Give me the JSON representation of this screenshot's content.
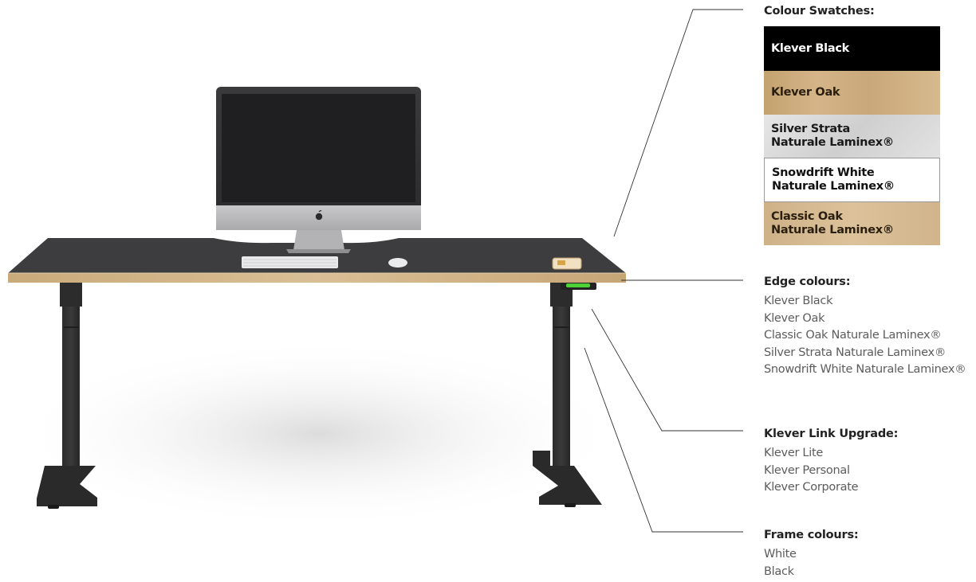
{
  "swatches": {
    "title": "Colour Swatches:",
    "items": [
      {
        "label": "Klever Black",
        "fill": "#000000",
        "text_color": "#ffffff"
      },
      {
        "label": "Klever Oak",
        "fill": "#c9a97b",
        "text_color": "#2a1e10"
      },
      {
        "label": "Silver Strata\nNaturale Laminex®",
        "fill": "#d9d9d9",
        "text_color": "#1a1a1a"
      },
      {
        "label": "Snowdrift White\nNaturale Laminex®",
        "fill": "#ffffff",
        "text_color": "#111111"
      },
      {
        "label": "Classic Oak\nNaturale Laminex®",
        "fill": "#d5b98f",
        "text_color": "#2a1e10"
      }
    ]
  },
  "edge": {
    "title": "Edge colours:",
    "items": [
      "Klever Black",
      "Klever Oak",
      "Classic Oak Naturale Laminex®",
      "Silver Strata Naturale Laminex®",
      "Snowdrift White Naturale Laminex®"
    ]
  },
  "link_upgrade": {
    "title": "Klever Link Upgrade:",
    "items": [
      "Klever Lite",
      "Klever Personal",
      "Klever Corporate"
    ]
  },
  "frame": {
    "title": "Frame colours:",
    "items": [
      "White",
      "Black"
    ]
  }
}
